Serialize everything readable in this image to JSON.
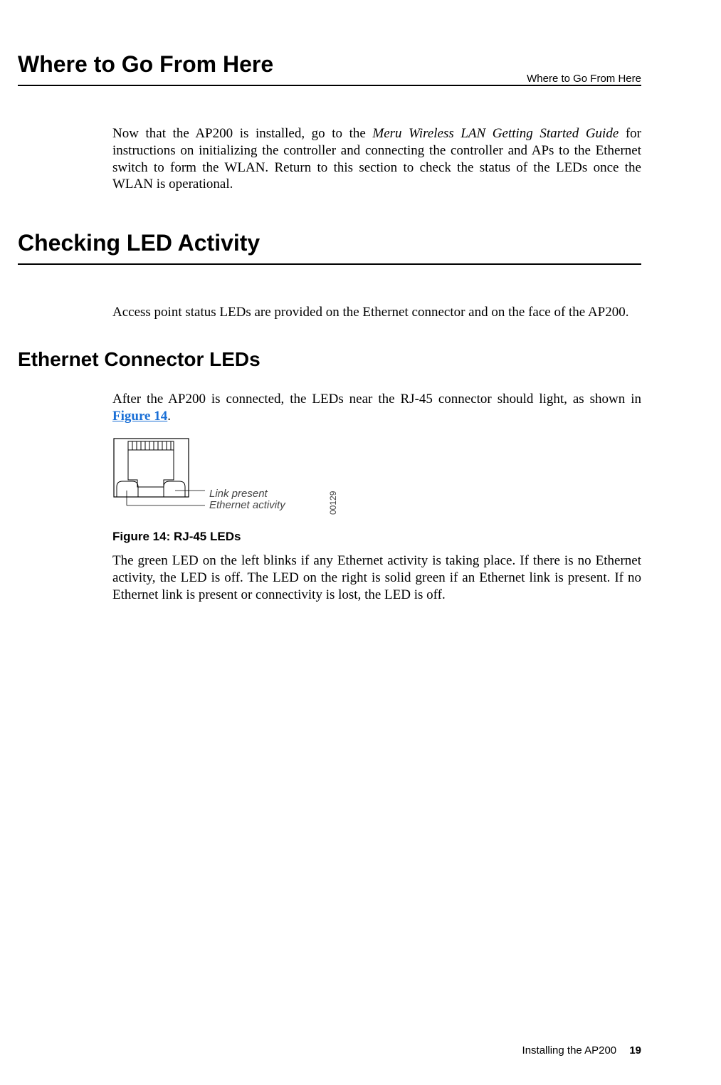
{
  "header": {
    "running_head": "Where to Go From Here"
  },
  "section1": {
    "title": "Where to Go From Here",
    "para_part1": "Now that the AP200 is installed, go to the ",
    "para_italic": "Meru Wireless LAN Getting Started Guide",
    "para_part2": " for instructions on initializing the controller and connecting the controller and APs to the Ethernet switch to form the WLAN. Return to this section to check the status of the LEDs once the WLAN is operational."
  },
  "section2": {
    "title": "Checking LED Activity",
    "para": "Access point status LEDs are provided on the Ethernet connector and on the face of the AP200."
  },
  "subsection": {
    "title": "Ethernet Connector LEDs",
    "para1_part1": "After the AP200 is connected, the LEDs near the RJ-45 connector should light, as shown in ",
    "para1_link": "Figure 14",
    "para1_part2": ".",
    "figure": {
      "label_top": "Link present",
      "label_bottom": "Ethernet activity",
      "code": "00129",
      "caption": "Figure 14: RJ-45 LEDs"
    },
    "para2": "The green LED on the left blinks if any Ethernet activity is taking place. If there is no Ethernet activity, the LED is off. The LED on the right is solid green if an Ethernet link is present. If no Ethernet link is present or connectivity is lost, the LED is off."
  },
  "footer": {
    "doc": "Installing the AP200",
    "page": "19"
  }
}
